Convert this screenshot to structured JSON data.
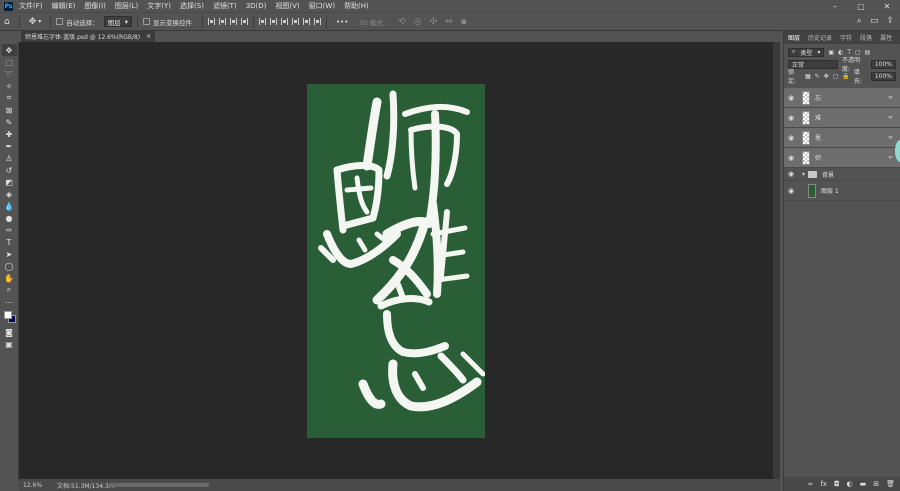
{
  "app": {
    "logo": "Ps"
  },
  "menu": [
    "文件(F)",
    "编辑(E)",
    "图像(I)",
    "图层(L)",
    "文字(Y)",
    "选择(S)",
    "滤镜(T)",
    "3D(D)",
    "视图(V)",
    "窗口(W)",
    "帮助(H)"
  ],
  "window_controls": {
    "minimize": "–",
    "maximize": "▢",
    "close": "✕"
  },
  "options": {
    "auto_select_label": "自动选择：",
    "auto_select_target": "图层",
    "show_transform_label": "显示变换控件",
    "more": "•••",
    "mode_3d": "3D 模式："
  },
  "document": {
    "tab_title": "师恩难忘字体-蓝版.psd @ 12.6%(RGB/8)",
    "tab_close": "×",
    "zoom": "12.6%",
    "doc_size": "文档:51.3M/134.3M",
    "background_color": "#2a5e37"
  },
  "panel": {
    "tabs": [
      "图层",
      "历史记录",
      "字符",
      "段落",
      "属性"
    ],
    "filter_label": "类型",
    "blend_mode": "正常",
    "opacity_label": "不透明度:",
    "opacity_value": "100%",
    "lock_label": "锁定:",
    "fill_label": "填充:",
    "fill_value": "100%",
    "layers": [
      {
        "name": "忘"
      },
      {
        "name": "难"
      },
      {
        "name": "恩"
      },
      {
        "name": "师"
      }
    ],
    "group_name": "背景",
    "bg_layer_name": "图层 1"
  },
  "colors": {
    "foreground": "#ffffff",
    "background": "#0b0b55",
    "artboard": "#2a5e37"
  }
}
